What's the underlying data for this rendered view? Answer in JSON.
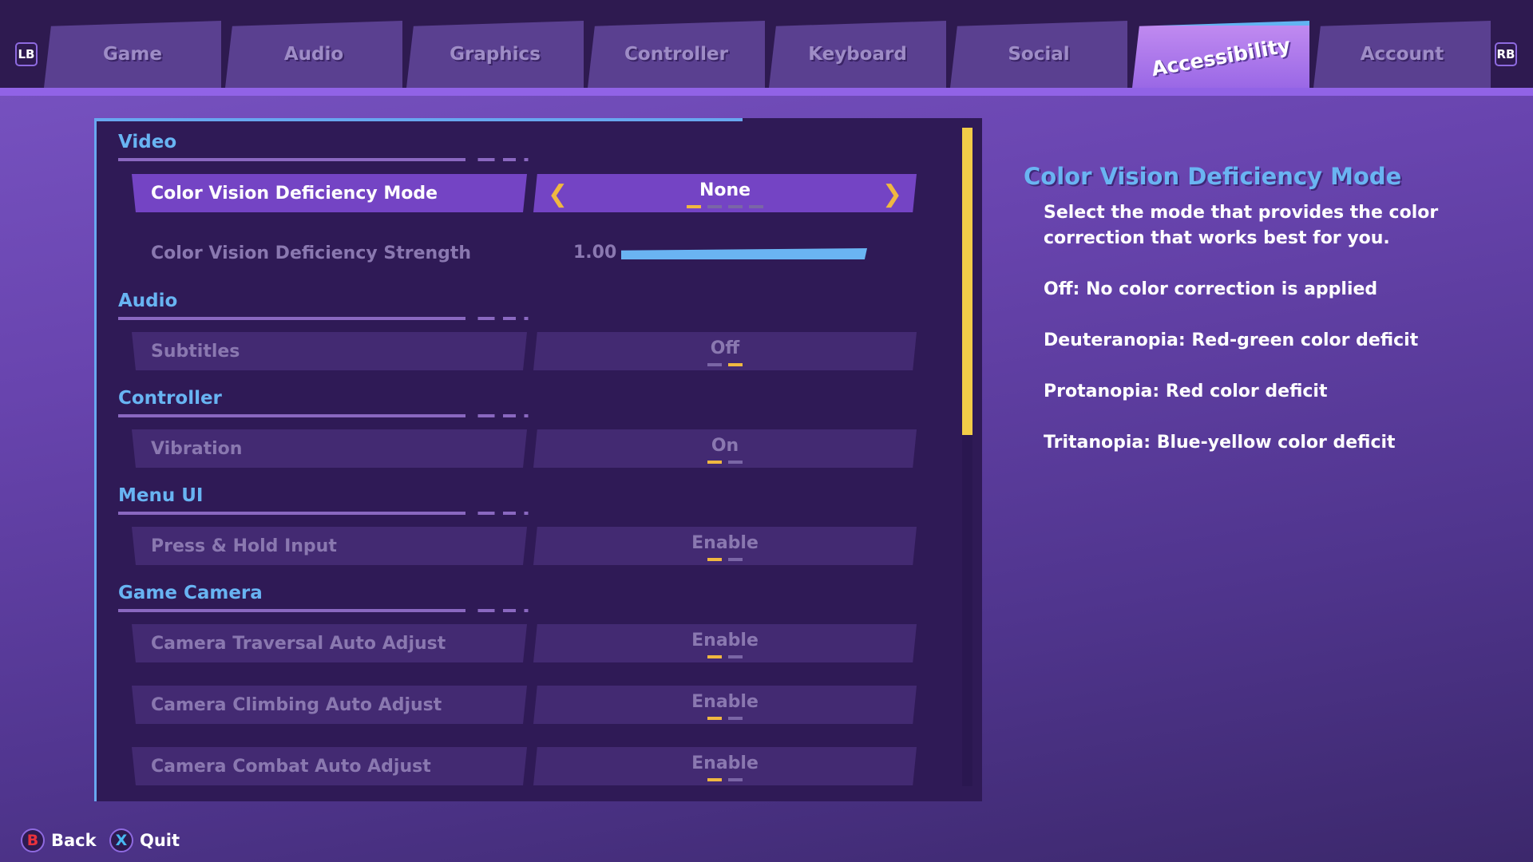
{
  "tabs": {
    "lb": "LB",
    "rb": "RB",
    "items": [
      "Game",
      "Audio",
      "Graphics",
      "Controller",
      "Keyboard",
      "Social",
      "Accessibility",
      "Account"
    ],
    "active": "Accessibility"
  },
  "sections": {
    "video": {
      "title": "Video",
      "mode_label": "Color Vision Deficiency Mode",
      "mode_value": "None",
      "mode_options_count": 4,
      "mode_selected_index": 0,
      "strength_label": "Color Vision Deficiency Strength",
      "strength_value": "1.00",
      "strength_fill": 1.0
    },
    "audio": {
      "title": "Audio",
      "subtitles_label": "Subtitles",
      "subtitles_value": "Off"
    },
    "controller": {
      "title": "Controller",
      "vibration_label": "Vibration",
      "vibration_value": "On"
    },
    "menu_ui": {
      "title": "Menu UI",
      "press_hold_label": "Press & Hold Input",
      "press_hold_value": "Enable"
    },
    "game_camera": {
      "title": "Game Camera",
      "traversal_label": "Camera Traversal Auto Adjust",
      "traversal_value": "Enable",
      "climbing_label": "Camera Climbing Auto Adjust",
      "climbing_value": "Enable",
      "combat_label": "Camera Combat Auto Adjust",
      "combat_value": "Enable"
    }
  },
  "help": {
    "title": "Color Vision Deficiency Mode",
    "lines": [
      "Select the mode that provides the color correction that works best for you.",
      "Off: No color correction is applied",
      "Deuteranopia: Red-green color deficit",
      "Protanopia: Red color deficit",
      "Tritanopia: Blue-yellow color deficit"
    ]
  },
  "footer": {
    "back_key": "B",
    "back_label": "Back",
    "quit_key": "X",
    "quit_label": "Quit"
  },
  "colors": {
    "accent_blue": "#6ab4f2",
    "highlight_yellow": "#f0b840",
    "b_button": "#e8323c",
    "x_button": "#48b8f0"
  }
}
